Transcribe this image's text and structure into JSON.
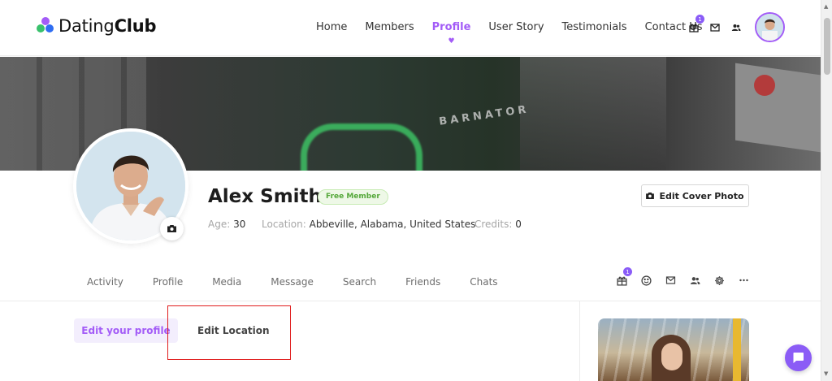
{
  "brand": {
    "name_light": "Dating",
    "name_bold": "Club"
  },
  "nav": {
    "items": [
      {
        "label": "Home",
        "active": false
      },
      {
        "label": "Members",
        "active": false
      },
      {
        "label": "Profile",
        "active": true
      },
      {
        "label": "User Story",
        "active": false
      },
      {
        "label": "Testimonials",
        "active": false
      },
      {
        "label": "Contact Us",
        "active": false
      }
    ]
  },
  "header_icons": {
    "gift_badge": "1"
  },
  "cover": {
    "sign_text": "BARNATOR",
    "edit_cover_label": "Edit Cover Photo"
  },
  "profile": {
    "name": "Alex Smith",
    "membership": "Free Member",
    "age_label": "Age:",
    "age": "30",
    "location_label": "Location:",
    "location": "Abbeville, Alabama, United States",
    "credits_label": "Credits:",
    "credits": "0"
  },
  "tabs": [
    "Activity",
    "Profile",
    "Media",
    "Message",
    "Search",
    "Friends",
    "Chats"
  ],
  "tab_icons": {
    "gift_badge": "1"
  },
  "subnav": {
    "edit_profile": "Edit your profile",
    "edit_location": "Edit Location"
  },
  "colors": {
    "accent": "#a35cf7",
    "badge_green": "#55a83a",
    "highlight": "#e01e1e"
  }
}
